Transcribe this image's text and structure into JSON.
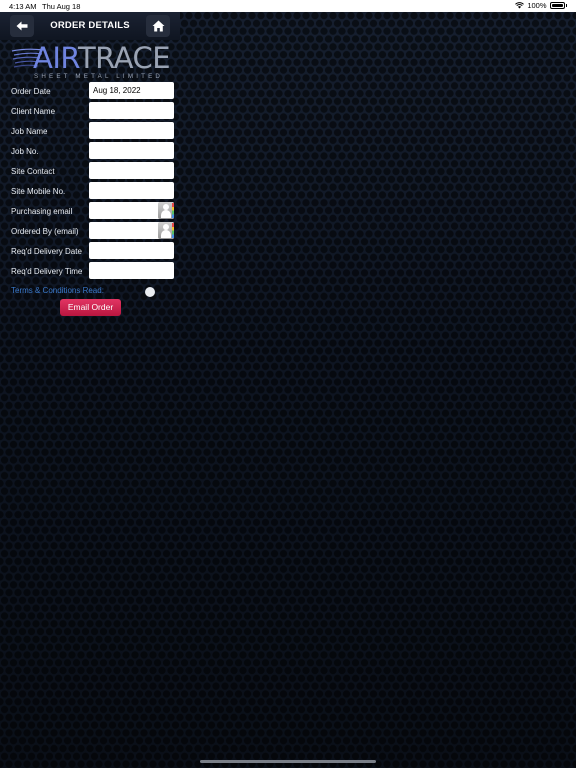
{
  "status_bar": {
    "time": "4:13 AM",
    "date": "Thu Aug 18",
    "battery": "100%"
  },
  "nav": {
    "title": "ORDER DETAILS",
    "back_icon": "back-arrow-icon",
    "home_icon": "home-icon"
  },
  "logo": {
    "brand_air": "AIR",
    "brand_trace": "TRACE",
    "tagline": "SHEET METAL LIMITED"
  },
  "form": {
    "fields": [
      {
        "label": "Order Date",
        "value": "Aug 18, 2022"
      },
      {
        "label": "Client Name",
        "value": ""
      },
      {
        "label": "Job Name",
        "value": ""
      },
      {
        "label": "Job No.",
        "value": ""
      },
      {
        "label": "Site Contact",
        "value": ""
      },
      {
        "label": "Site Mobile No.",
        "value": ""
      },
      {
        "label": "Purchasing email",
        "value": ""
      },
      {
        "label": "Ordered By (email)",
        "value": ""
      },
      {
        "label": "Req'd Delivery Date",
        "value": ""
      },
      {
        "label": "Req'd Delivery Time",
        "value": ""
      }
    ],
    "terms_label": "Terms & Conditions Read:",
    "email_button": "Email Order"
  },
  "colors": {
    "accent_blue": "#3a78c9",
    "button_red": "#d42856",
    "logo_blue": "#6f84e0"
  }
}
